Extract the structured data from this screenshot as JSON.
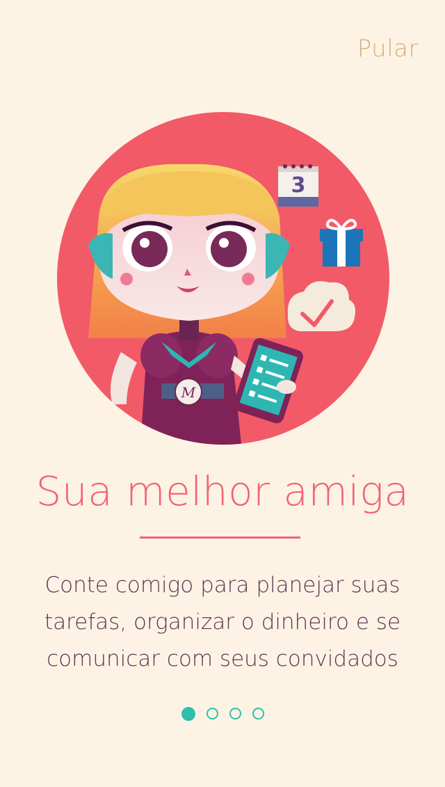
{
  "header": {
    "skip_label": "Pular"
  },
  "illustration": {
    "calendar_day": "3",
    "badge_letter": "M"
  },
  "onboarding": {
    "title": "Sua melhor amiga",
    "description_lines": [
      "Conte comigo para planejar suas",
      "tarefas, organizar o dinheiro e se",
      "comunicar com seus convidados"
    ]
  },
  "pagination": {
    "total": 4,
    "active_index": 0
  },
  "colors": {
    "background": "#fdf3e5",
    "accent": "#f1636f",
    "text": "#5d3454",
    "skip": "#d2ae7e",
    "dots": "#2ebfae"
  }
}
